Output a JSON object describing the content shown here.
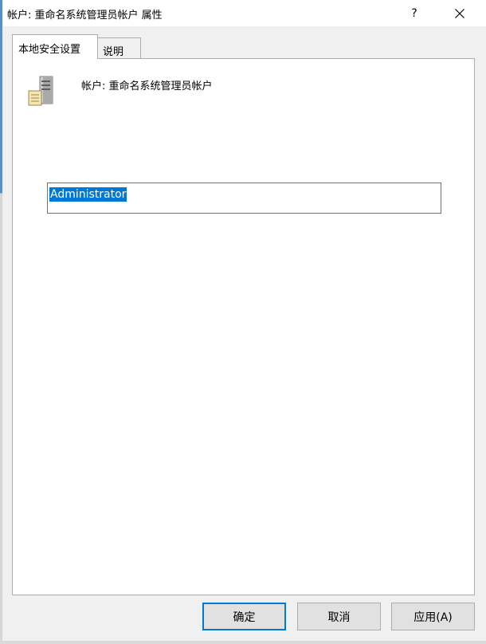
{
  "window": {
    "title": "帐户: 重命名系统管理员帐户 属性",
    "help_label": "?"
  },
  "tabs": [
    {
      "label": "本地安全设置",
      "active": true
    },
    {
      "label": "说明",
      "active": false
    }
  ],
  "panel": {
    "icon": "server-icon",
    "account_label": "帐户: 重命名系统管理员帐户",
    "input_value": "Administrator"
  },
  "buttons": {
    "ok": "确定",
    "cancel": "取消",
    "apply": "应用(A)"
  },
  "colors": {
    "selection": "#0078d7",
    "input_border": "#3c7fb1",
    "default_button_border": "#0078d7"
  }
}
